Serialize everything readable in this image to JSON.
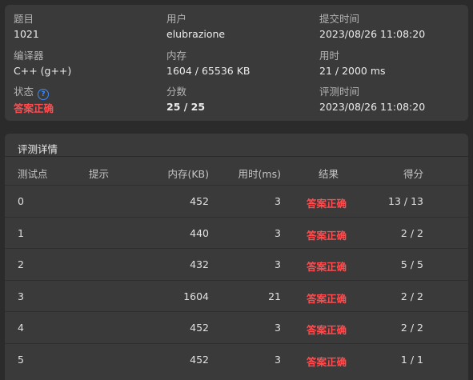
{
  "summary": {
    "problem": {
      "label": "题目",
      "value": "1021"
    },
    "user": {
      "label": "用户",
      "value": "elubrazione"
    },
    "submit_time": {
      "label": "提交时间",
      "value": "2023/08/26 11:08:20"
    },
    "compiler": {
      "label": "编译器",
      "value": "C++ (g++)"
    },
    "memory": {
      "label": "内存",
      "value": "1604 / 65536 KB"
    },
    "time": {
      "label": "用时",
      "value": "21 / 2000 ms"
    },
    "status": {
      "label": "状态",
      "value": "答案正确",
      "help_icon": "?"
    },
    "score": {
      "label": "分数",
      "value": "25 / 25"
    },
    "judge_time": {
      "label": "评测时间",
      "value": "2023/08/26 11:08:20"
    }
  },
  "details": {
    "title": "评测详情",
    "headers": {
      "testcase": "测试点",
      "hint": "提示",
      "memory": "内存(KB)",
      "time": "用时(ms)",
      "result": "结果",
      "score": "得分"
    },
    "rows": [
      {
        "testcase": "0",
        "hint": "",
        "memory": "452",
        "time": "3",
        "result": "答案正确",
        "score": "13 / 13"
      },
      {
        "testcase": "1",
        "hint": "",
        "memory": "440",
        "time": "3",
        "result": "答案正确",
        "score": "2 / 2"
      },
      {
        "testcase": "2",
        "hint": "",
        "memory": "432",
        "time": "3",
        "result": "答案正确",
        "score": "5 / 5"
      },
      {
        "testcase": "3",
        "hint": "",
        "memory": "1604",
        "time": "21",
        "result": "答案正确",
        "score": "2 / 2"
      },
      {
        "testcase": "4",
        "hint": "",
        "memory": "452",
        "time": "3",
        "result": "答案正确",
        "score": "2 / 2"
      },
      {
        "testcase": "5",
        "hint": "",
        "memory": "452",
        "time": "3",
        "result": "答案正确",
        "score": "1 / 1"
      }
    ]
  },
  "colors": {
    "background": "#2b2b2b",
    "card": "#3a3a3a",
    "accepted": "#ff4d4f",
    "help_icon": "#3d8bfd"
  }
}
